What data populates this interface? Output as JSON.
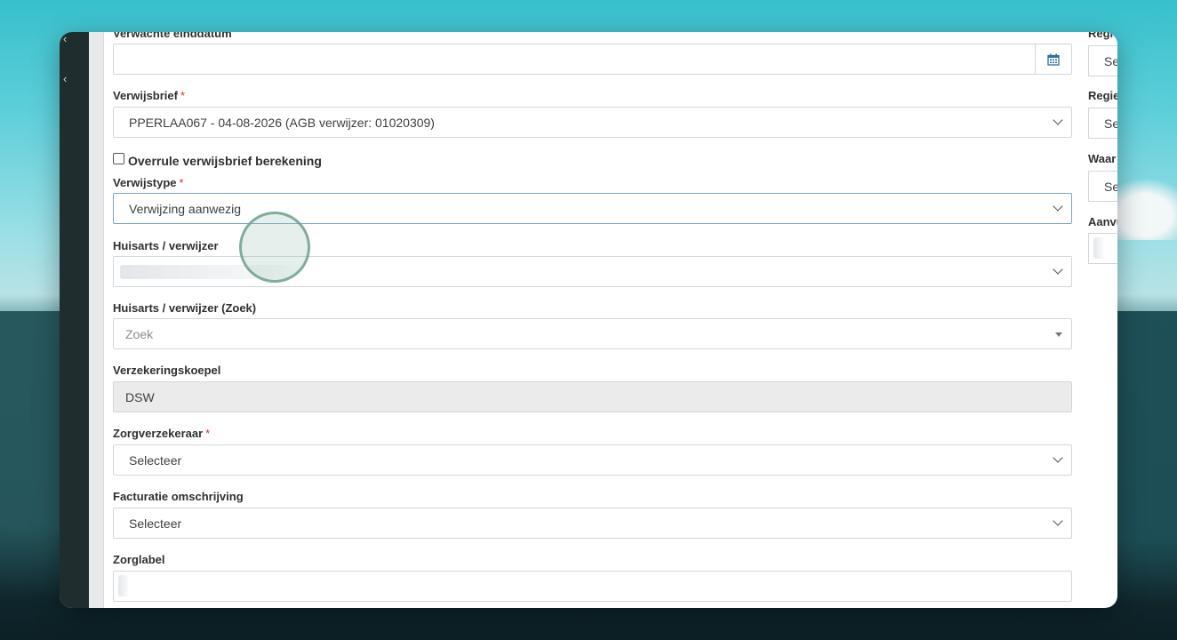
{
  "colors": {
    "accent_focus": "#7aa6c8",
    "required": "#d0342c",
    "rail": "#1f2d2f",
    "disabled_bg": "#ebebeb"
  },
  "form": {
    "expected_end_date": {
      "label": "Verwachte einddatum",
      "value": "",
      "icon": "calendar-icon"
    },
    "referral_letter": {
      "label": "Verwijsbrief",
      "required_mark": "*",
      "value": "PPERLAA067 - 04-08-2026 (AGB verwijzer: 01020309)"
    },
    "override_checkbox": {
      "label": "Overrule verwijsbrief berekening",
      "checked": false
    },
    "referral_type": {
      "label": "Verwijstype",
      "required_mark": "*",
      "value": "Verwijzing aanwezig"
    },
    "gp_referrer": {
      "label": "Huisarts / verwijzer",
      "value": ""
    },
    "gp_referrer_search": {
      "label": "Huisarts / verwijzer (Zoek)",
      "placeholder": "Zoek"
    },
    "insurance_umbrella": {
      "label": "Verzekeringskoepel",
      "value": "DSW"
    },
    "insurer": {
      "label": "Zorgverzekeraar",
      "required_mark": "*",
      "value": "Selecteer"
    },
    "billing_description": {
      "label": "Facturatie omschrijving",
      "value": "Selecteer"
    },
    "care_label": {
      "label": "Zorglabel",
      "value": ""
    }
  },
  "right_column": {
    "field1": {
      "label": "Regie",
      "value": "Se"
    },
    "field2": {
      "label": "Regie",
      "value": "Se"
    },
    "field3": {
      "label": "Waar",
      "value": "Se"
    },
    "field4": {
      "label": "Aanvu",
      "value": ""
    }
  }
}
